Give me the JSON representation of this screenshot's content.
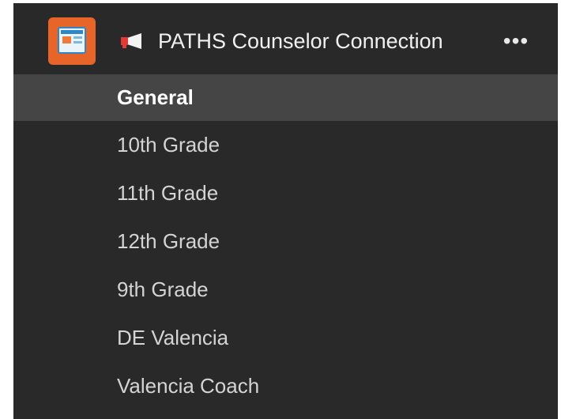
{
  "team": {
    "name": "PATHS Counselor Connection",
    "more_label": "•••",
    "avatar_icon": "classroom-screen-icon",
    "avatar_color": "#e8652a",
    "pinned_icon": "megaphone-icon"
  },
  "channels": [
    {
      "label": "General",
      "selected": true
    },
    {
      "label": "10th Grade",
      "selected": false
    },
    {
      "label": "11th Grade",
      "selected": false
    },
    {
      "label": "12th Grade",
      "selected": false
    },
    {
      "label": "9th Grade",
      "selected": false
    },
    {
      "label": "DE Valencia",
      "selected": false
    },
    {
      "label": "Valencia Coach",
      "selected": false
    }
  ],
  "colors": {
    "panel_bg": "#292929",
    "selected_bg": "#454545",
    "text": "#d4d4d4"
  }
}
